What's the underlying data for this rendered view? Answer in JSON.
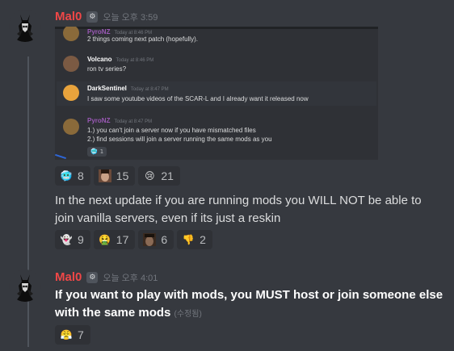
{
  "messages": [
    {
      "author": "Mal0",
      "timestamp": "오늘 오후 3:59",
      "tag_icon": "gear-tag-icon",
      "text": "In the next update if you are running mods you WILL NOT be able to join vanilla servers, even if its just a reskin",
      "embed": {
        "messages": [
          {
            "author": "PyroNZ",
            "time": "Today at 8:46 PM",
            "text": "2 things coming next patch (hopefully)."
          },
          {
            "author": "Volcano",
            "time": "Today at 8:46 PM",
            "text": "ron tv series?"
          },
          {
            "author": "DarkSentinel",
            "time": "Today at 8:47 PM",
            "text": "I saw some youtube videos of the SCAR-L and I already want it released now"
          },
          {
            "author": "PyroNZ",
            "time": "Today at 8:47 PM",
            "lines": [
              "1.) you can't join a server now if you have mismatched files",
              "2.) find sessions will join a server running the same mods as you"
            ],
            "reaction_count": "1"
          }
        ]
      },
      "reactions_top": [
        {
          "emoji": "cold-face-icon",
          "glyph": "🥶",
          "count": "8"
        },
        {
          "emoji": "custom-face-icon",
          "glyph": "",
          "count": "15"
        },
        {
          "emoji": "crying-face-icon",
          "glyph": "😢",
          "count": "21"
        }
      ],
      "reactions_bottom": [
        {
          "emoji": "ghost-face-icon",
          "glyph": "👻",
          "count": "9"
        },
        {
          "emoji": "nauseated-face-icon",
          "glyph": "🤮",
          "count": "17"
        },
        {
          "emoji": "custom-man-icon",
          "glyph": "",
          "count": "6"
        },
        {
          "emoji": "thumbs-down-icon",
          "glyph": "👎",
          "count": "2"
        }
      ]
    },
    {
      "author": "Mal0",
      "timestamp": "오늘 오후 4:01",
      "tag_icon": "gear-tag-icon",
      "text_line1": "If you want to play with mods, you MUST host or join someone else",
      "text_line2": "with the same mods",
      "edited": "(수정됨)",
      "reactions": [
        {
          "emoji": "angry-face-icon",
          "glyph": "😤",
          "count": "7"
        }
      ]
    }
  ],
  "colors": {
    "username": "#f04747",
    "background": "#36393f",
    "reaction_bg": "#2f3136"
  }
}
